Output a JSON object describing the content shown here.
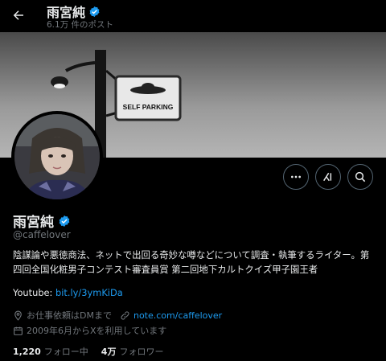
{
  "header": {
    "name": "雨宮純",
    "post_count": "6.1万 件のポスト"
  },
  "banner": {
    "sign_text": "SELF PARKING"
  },
  "profile": {
    "name": "雨宮純",
    "handle": "@caffelover",
    "bio": "陰謀論や悪徳商法、ネットで出回る奇妙な噂などについて調査・執筆するライター。第四回全国化粧男子コンテスト審査員賞 第二回地下カルトクイズ甲子園王者",
    "youtube_label": "Youtube:",
    "youtube_link": "bit.ly/3ymKiDa",
    "job_text": "お仕事依頼はDMまで",
    "website": "note.com/caffelover",
    "joined": "2009年6月からXを利用しています"
  },
  "stats": {
    "following_count": "1,220",
    "following_label": "フォロー中",
    "followers_count": "4万",
    "followers_label": "フォロワー"
  },
  "colors": {
    "background": "#000000",
    "text": "#e7e9ea",
    "muted": "#71767b",
    "link": "#1d9bf0",
    "verified": "#1d9bf0"
  }
}
